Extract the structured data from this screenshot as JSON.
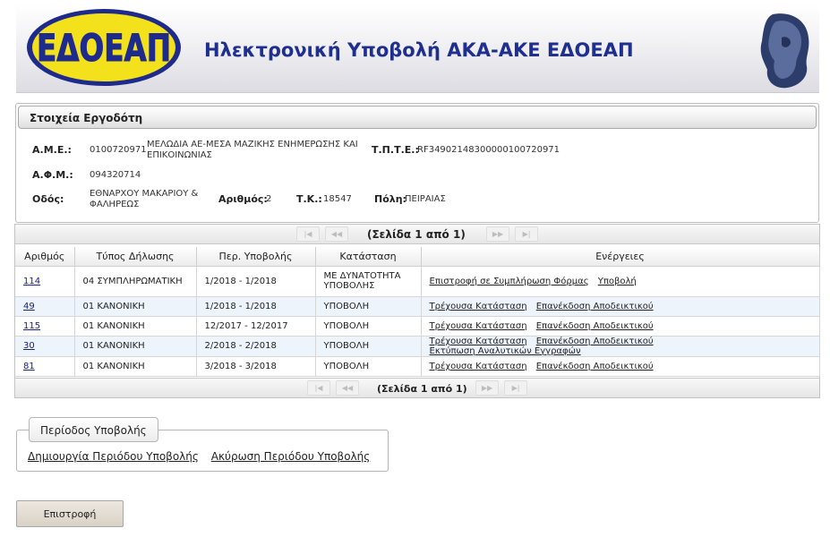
{
  "banner": {
    "logo_text": "ΕΔΟΕΑΠ",
    "title": "Ηλεκτρονική Υποβολή ΑΚΑ-ΑΚΕ ΕΔΟΕΑΠ"
  },
  "employer": {
    "heading": "Στοιχεία Εργοδότη",
    "ame_label": "Α.Μ.Ε.:",
    "ame_value": "0100720971",
    "name_value": "ΜΕΛΩΔΙΑ ΑΕ-ΜΕΣΑ ΜΑΖΙΚΗΣ ΕΝΗΜΕΡΩΣΗΣ ΚΑΙ ΕΠΙΚΟΙΝΩΝΙΑΣ",
    "tpte_label": "Τ.Π.Τ.Ε.:",
    "tpte_value": "RF34902148300000100720971",
    "afm_label": "Α.Φ.Μ.:",
    "afm_value": "094320714",
    "street_label": "Οδός:",
    "street_value": "ΕΘΝΑΡΧΟΥ ΜΑΚΑΡΙΟΥ & ΦΑΛΗΡΕΩΣ",
    "number_label": "Αριθμός:",
    "number_value": "2",
    "tk_label": "Τ.Κ.:",
    "tk_value": "18547",
    "city_label": "Πόλη:",
    "city_value": "ΠΕΙΡΑΙΑΣ"
  },
  "grid": {
    "page_text": "(Σελίδα 1 από 1)",
    "columns": [
      "Αριθμός",
      "Τύπος Δήλωσης",
      "Περ. Υποβολής",
      "Κατάσταση",
      "Ενέργειες"
    ],
    "rows": [
      {
        "number": "114",
        "type": "04 ΣΥΜΠΛΗΡΩΜΑΤΙΚΗ",
        "period": "1/2018 - 1/2018",
        "status": "ΜΕ ΔΥΝΑΤΟΤΗΤΑ ΥΠΟΒΟΛΗΣ",
        "actions": [
          "Επιστροφή σε Συμπλήρωση Φόρμας",
          "Υποβολή"
        ]
      },
      {
        "number": "49",
        "type": "01 ΚΑΝΟΝΙΚΗ",
        "period": "1/2018 - 1/2018",
        "status": "ΥΠΟΒΟΛΗ",
        "actions": [
          "Τρέχουσα Κατάσταση",
          "Επανέκδοση Αποδεικτικού"
        ]
      },
      {
        "number": "115",
        "type": "01 ΚΑΝΟΝΙΚΗ",
        "period": "12/2017 - 12/2017",
        "status": "ΥΠΟΒΟΛΗ",
        "actions": [
          "Τρέχουσα Κατάσταση",
          "Επανέκδοση Αποδεικτικού"
        ]
      },
      {
        "number": "30",
        "type": "01 ΚΑΝΟΝΙΚΗ",
        "period": "2/2018 - 2/2018",
        "status": "ΥΠΟΒΟΛΗ",
        "actions": [
          "Τρέχουσα Κατάσταση",
          "Επανέκδοση Αποδεικτικού",
          "Εκτύπωση Αναλυτικών Εγγραφών"
        ]
      },
      {
        "number": "81",
        "type": "01 ΚΑΝΟΝΙΚΗ",
        "period": "3/2018 - 3/2018",
        "status": "ΥΠΟΒΟΛΗ",
        "actions": [
          "Τρέχουσα Κατάσταση",
          "Επανέκδοση Αποδεικτικού"
        ]
      }
    ]
  },
  "period": {
    "legend": "Περίοδος Υποβολής",
    "create_link": "Δημιουργία Περιόδου Υποβολής",
    "cancel_link": "Ακύρωση Περιόδου Υποβολής"
  },
  "back_button": "Επιστροφή",
  "colors": {
    "title_blue": "#1f2f8f",
    "logo_yellow": "#f3e21b",
    "logo_blue": "#1e2b8c"
  }
}
